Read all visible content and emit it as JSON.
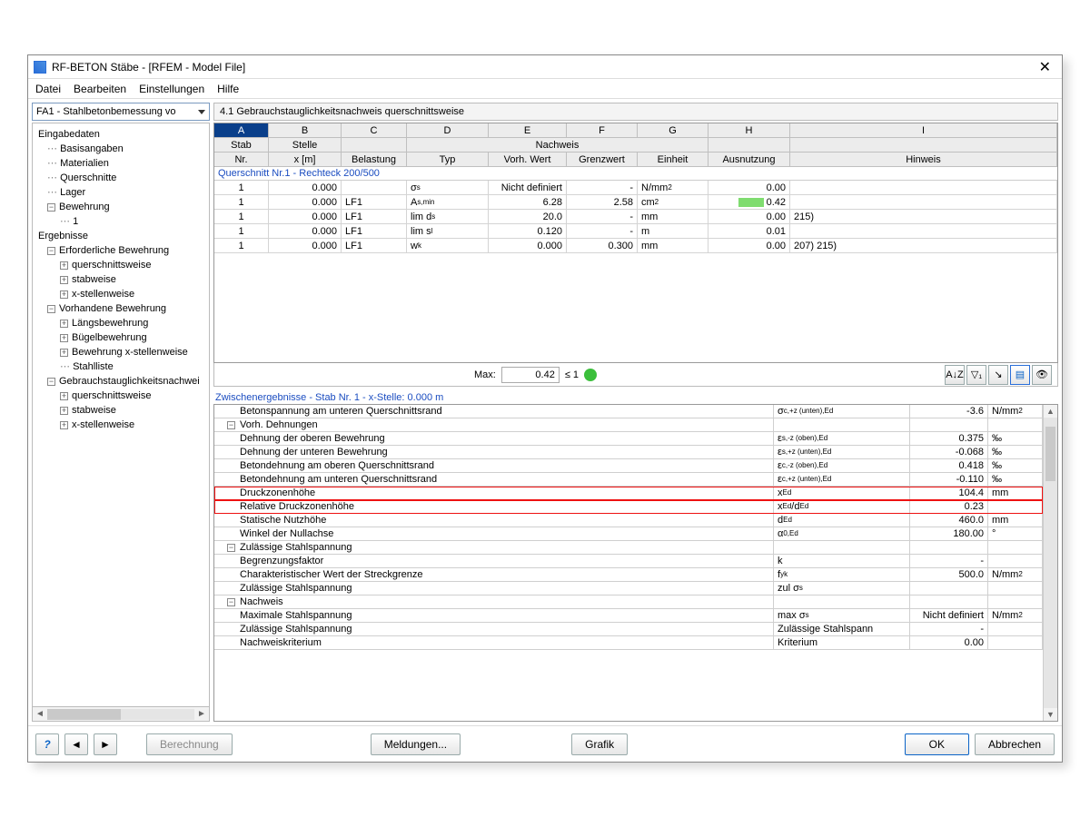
{
  "window": {
    "title": "RF-BETON Stäbe - [RFEM - Model File]"
  },
  "menu": {
    "datei": "Datei",
    "bearbeiten": "Bearbeiten",
    "einstellungen": "Einstellungen",
    "hilfe": "Hilfe"
  },
  "selector": {
    "value": "FA1 - Stahlbetonbemessung vo"
  },
  "tree": {
    "eingabedaten": "Eingabedaten",
    "basisangaben": "Basisangaben",
    "materialien": "Materialien",
    "querschnitte": "Querschnitte",
    "lager": "Lager",
    "bewehrung": "Bewehrung",
    "bew1": "1",
    "ergebnisse": "Ergebnisse",
    "erf_bew": "Erforderliche Bewehrung",
    "qsw": "querschnittsweise",
    "sw": "stabweise",
    "xsw": "x-stellenweise",
    "vorh_bew": "Vorhandene Bewehrung",
    "laengs": "Längsbewehrung",
    "buegel": "Bügelbewehrung",
    "bew_x": "Bewehrung x-stellenweise",
    "stahlliste": "Stahlliste",
    "gebr": "Gebrauchstauglichkeitsnachwei"
  },
  "panel": {
    "title": "4.1 Gebrauchstauglichkeitsnachweis querschnittsweise"
  },
  "headers_top": {
    "A": "A",
    "B": "B",
    "C": "C",
    "D": "D",
    "E": "E",
    "F": "F",
    "G": "G",
    "H": "H",
    "I": "I"
  },
  "headers_mid": {
    "stab": "Stab",
    "stelle": "Stelle",
    "nachweis": "Nachweis"
  },
  "headers_sub": {
    "nr": "Nr.",
    "xm": "x [m]",
    "belastung": "Belastung",
    "typ": "Typ",
    "vorh": "Vorh. Wert",
    "grenz": "Grenzwert",
    "einheit": "Einheit",
    "ausnutzung": "Ausnutzung",
    "hinweis": "Hinweis"
  },
  "section_label": "Querschnitt Nr.1  -  Rechteck 200/500",
  "rows": [
    {
      "nr": "1",
      "x": "0.000",
      "bl": "",
      "typ": "σ<sub>s</sub>",
      "vorh": "Nicht definiert",
      "grenz": "-",
      "einh": "N/mm<sup>2</sup>",
      "aus": "0.00",
      "bar": false,
      "hin": ""
    },
    {
      "nr": "1",
      "x": "0.000",
      "bl": "LF1",
      "typ": "A<sub>s,min</sub>",
      "vorh": "6.28",
      "grenz": "2.58",
      "einh": "cm<sup>2</sup>",
      "aus": "0.42",
      "bar": true,
      "hin": ""
    },
    {
      "nr": "1",
      "x": "0.000",
      "bl": "LF1",
      "typ": "lim d<sub>s</sub>",
      "vorh": "20.0",
      "grenz": "-",
      "einh": "mm",
      "aus": "0.00",
      "bar": false,
      "hin": "215)"
    },
    {
      "nr": "1",
      "x": "0.000",
      "bl": "LF1",
      "typ": "lim s<sub>l</sub>",
      "vorh": "0.120",
      "grenz": "-",
      "einh": "m",
      "aus": "0.01",
      "bar": false,
      "hin": ""
    },
    {
      "nr": "1",
      "x": "0.000",
      "bl": "LF1",
      "typ": "w<sub>k</sub>",
      "vorh": "0.000",
      "grenz": "0.300",
      "einh": "mm",
      "aus": "0.00",
      "bar": false,
      "hin": "207) 215)"
    }
  ],
  "maxbar": {
    "label": "Max:",
    "value": "0.42",
    "le": "≤ 1"
  },
  "detail_header": "Zwischenergebnisse -  Stab Nr. 1  -  x-Stelle: 0.000 m",
  "details": [
    {
      "t": "row",
      "label": "Betonspannung am unteren Querschnittsrand",
      "sym": "σ<sub>c,+z (unten),Ed</sub>",
      "val": "-3.6",
      "unit": "N/mm<sup>2</sup>"
    },
    {
      "t": "grp",
      "label": "Vorh. Dehnungen"
    },
    {
      "t": "row",
      "label": "Dehnung der oberen Bewehrung",
      "sym": "ε<sub>s,-z (oben),Ed</sub>",
      "val": "0.375",
      "unit": "‰"
    },
    {
      "t": "row",
      "label": "Dehnung der unteren Bewehrung",
      "sym": "ε<sub>s,+z (unten),Ed</sub>",
      "val": "-0.068",
      "unit": "‰"
    },
    {
      "t": "row",
      "label": "Betondehnung am oberen Querschnittsrand",
      "sym": "ε<sub>c,-z (oben),Ed</sub>",
      "val": "0.418",
      "unit": "‰"
    },
    {
      "t": "row",
      "label": "Betondehnung am unteren Querschnittsrand",
      "sym": "ε<sub>c,+z (unten),Ed</sub>",
      "val": "-0.110",
      "unit": "‰"
    },
    {
      "t": "row",
      "hl": true,
      "label": "Druckzonenhöhe",
      "sym": "x<sub>Ed</sub>",
      "val": "104.4",
      "unit": "mm"
    },
    {
      "t": "row",
      "hl": true,
      "label": "Relative Druckzonenhöhe",
      "sym": "x<sub>Ed</sub>/d<sub>Ed</sub>",
      "val": "0.23",
      "unit": ""
    },
    {
      "t": "row",
      "label": "Statische Nutzhöhe",
      "sym": "d<sub>Ed</sub>",
      "val": "460.0",
      "unit": "mm"
    },
    {
      "t": "row",
      "label": "Winkel der Nullachse",
      "sym": "α<sub>0,Ed</sub>",
      "val": "180.00",
      "unit": "°"
    },
    {
      "t": "grp",
      "label": "Zulässige Stahlspannung"
    },
    {
      "t": "row",
      "label": "Begrenzungsfaktor",
      "sym": "k",
      "val": "-",
      "unit": ""
    },
    {
      "t": "row",
      "label": "Charakteristischer Wert der Streckgrenze",
      "sym": "f<sub>yk</sub>",
      "val": "500.0",
      "unit": "N/mm<sup>2</sup>"
    },
    {
      "t": "row",
      "label": "Zulässige Stahlspannung",
      "sym": "zul σ<sub>s</sub>",
      "val": "",
      "unit": ""
    },
    {
      "t": "grp",
      "label": "Nachweis"
    },
    {
      "t": "row",
      "label": "Maximale Stahlspannung",
      "sym": "max σ<sub>s</sub>",
      "val": "Nicht definiert",
      "unit": "N/mm<sup>2</sup>"
    },
    {
      "t": "row",
      "label": "Zulässige Stahlspannung",
      "sym": "Zulässige Stahlspann",
      "val": "-",
      "unit": ""
    },
    {
      "t": "row",
      "label": "Nachweiskriterium",
      "sym": "Kriterium",
      "val": "0.00",
      "unit": ""
    }
  ],
  "footer": {
    "berechnung": "Berechnung",
    "meldungen": "Meldungen...",
    "grafik": "Grafik",
    "ok": "OK",
    "abbrechen": "Abbrechen"
  }
}
